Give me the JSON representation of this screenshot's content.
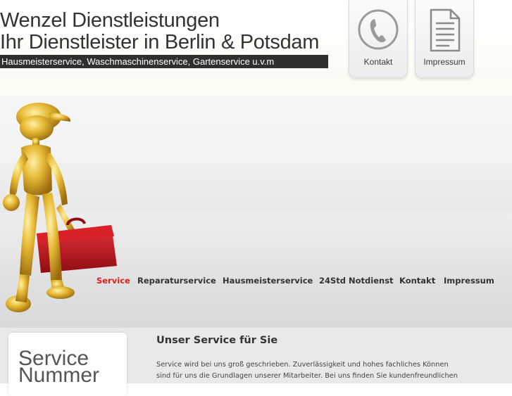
{
  "header": {
    "title_line1": "Wenzel Dienstleistungen",
    "title_line2": "Ihr Dienstleister in Berlin & Potsdam",
    "tagline": "Hausmeisterservice, Waschmaschinenservice, Gartenservice u.v.m"
  },
  "top_buttons": [
    {
      "label": "Kontakt",
      "icon": "phone-icon"
    },
    {
      "label": "Impressum",
      "icon": "document-icon"
    }
  ],
  "banner": {
    "image": "golden-handyman-figure",
    "colors": {
      "toolbox": "#c4161c",
      "figure": "#e0b431",
      "nav_active": "#e0201a"
    }
  },
  "nav": {
    "items": [
      {
        "label": "Service",
        "active": true
      },
      {
        "label": "Reparaturservice",
        "active": false
      },
      {
        "label": "Hausmeisterservice",
        "active": false
      },
      {
        "label": "24Std Notdienst",
        "active": false
      },
      {
        "label": "Kontakt",
        "active": false
      },
      {
        "label": "Impressum",
        "active": false
      }
    ]
  },
  "sidebar": {
    "box_line1": "Service",
    "box_line2": "Nummer"
  },
  "main": {
    "heading": "Unser Service für Sie",
    "text_line1": "Service wird bei uns groß geschrieben. Zuverlässigkeit und hohes fachliches Können",
    "text_line2": "sind für uns die Grundlagen unserer Mitarbeiter. Bei uns finden Sie kundenfreundlichen"
  }
}
